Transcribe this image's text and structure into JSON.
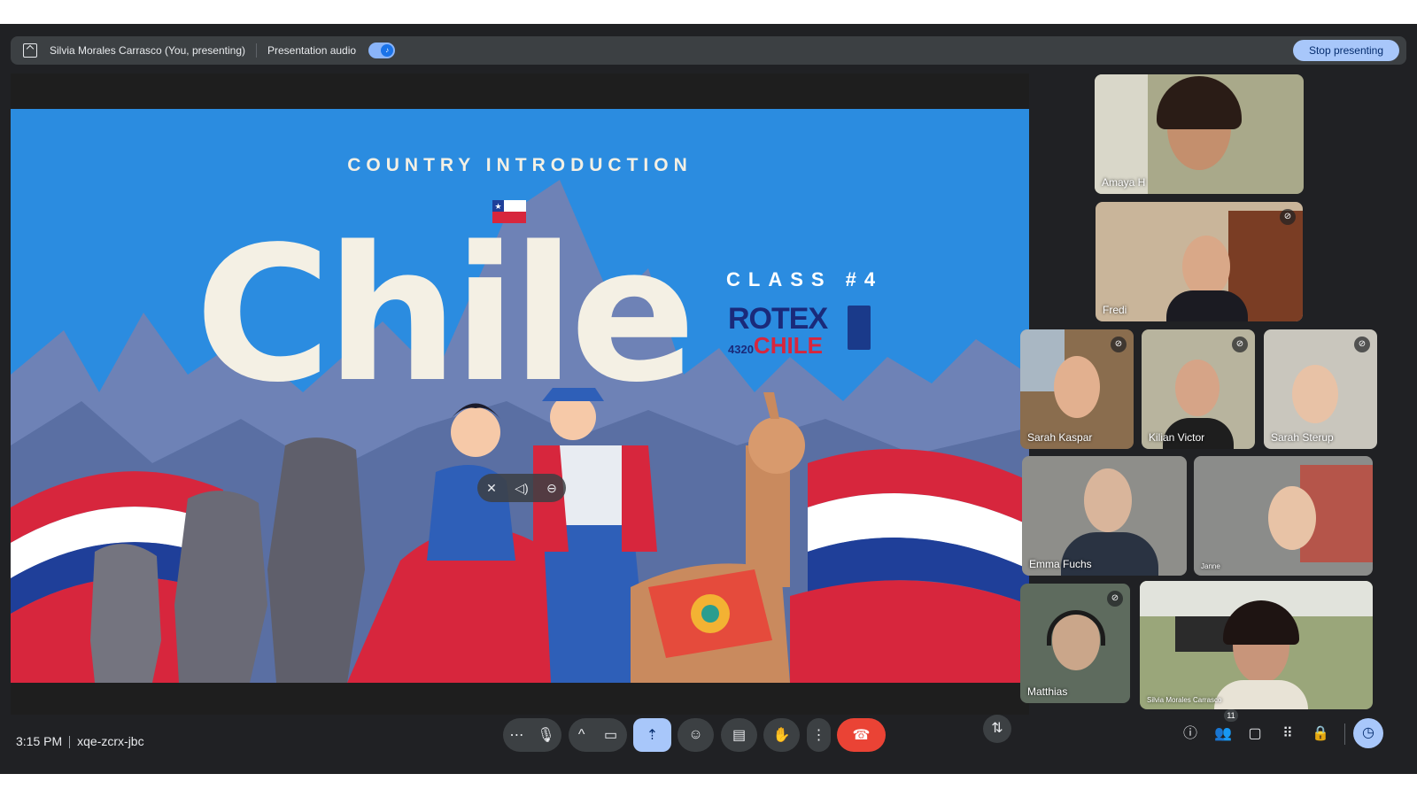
{
  "topbar": {
    "presenter": "Silvia Morales Carrasco (You, presenting)",
    "audio_label": "Presentation audio",
    "stop_label": "Stop presenting"
  },
  "slide": {
    "heading": "COUNTRY INTRODUCTION",
    "title": "Chile",
    "class_label": "CLASS #4",
    "logo_rotex": "ROTEX",
    "logo_number": "4320",
    "logo_chile": "CHILE"
  },
  "participants": [
    {
      "name": "Amaya H",
      "muted": false
    },
    {
      "name": "Fredi",
      "muted": true
    },
    {
      "name": "Sarah Kaspar",
      "muted": true
    },
    {
      "name": "Kilian Victor",
      "muted": true
    },
    {
      "name": "Sarah Sterup",
      "muted": true
    },
    {
      "name": "Emma Fuchs",
      "muted": false
    },
    {
      "name": "Janne",
      "muted": false
    },
    {
      "name": "Matthias",
      "muted": true
    },
    {
      "name": "Silvia Morales Carrasco",
      "muted": false
    }
  ],
  "meeting": {
    "time": "3:15 PM",
    "code": "xqe-zcrx-jbc",
    "participant_count": "11"
  },
  "icons": {
    "more": "more-horiz-icon",
    "mic": "mic-icon",
    "camera": "videocam-icon",
    "present": "present-icon",
    "emoji": "emoji-icon",
    "captions": "captions-icon",
    "hand": "raise-hand-icon",
    "menu": "more-vert-icon",
    "end": "call-end-icon",
    "info": "info-icon",
    "people": "people-icon",
    "chat": "chat-icon",
    "activities": "apps-icon",
    "lock": "host-controls-icon",
    "timer": "timer-icon"
  },
  "colors": {
    "background": "#202124",
    "accent": "#a8c7fa",
    "end_call": "#ea4335",
    "slide_blue": "#2b8ce0"
  }
}
